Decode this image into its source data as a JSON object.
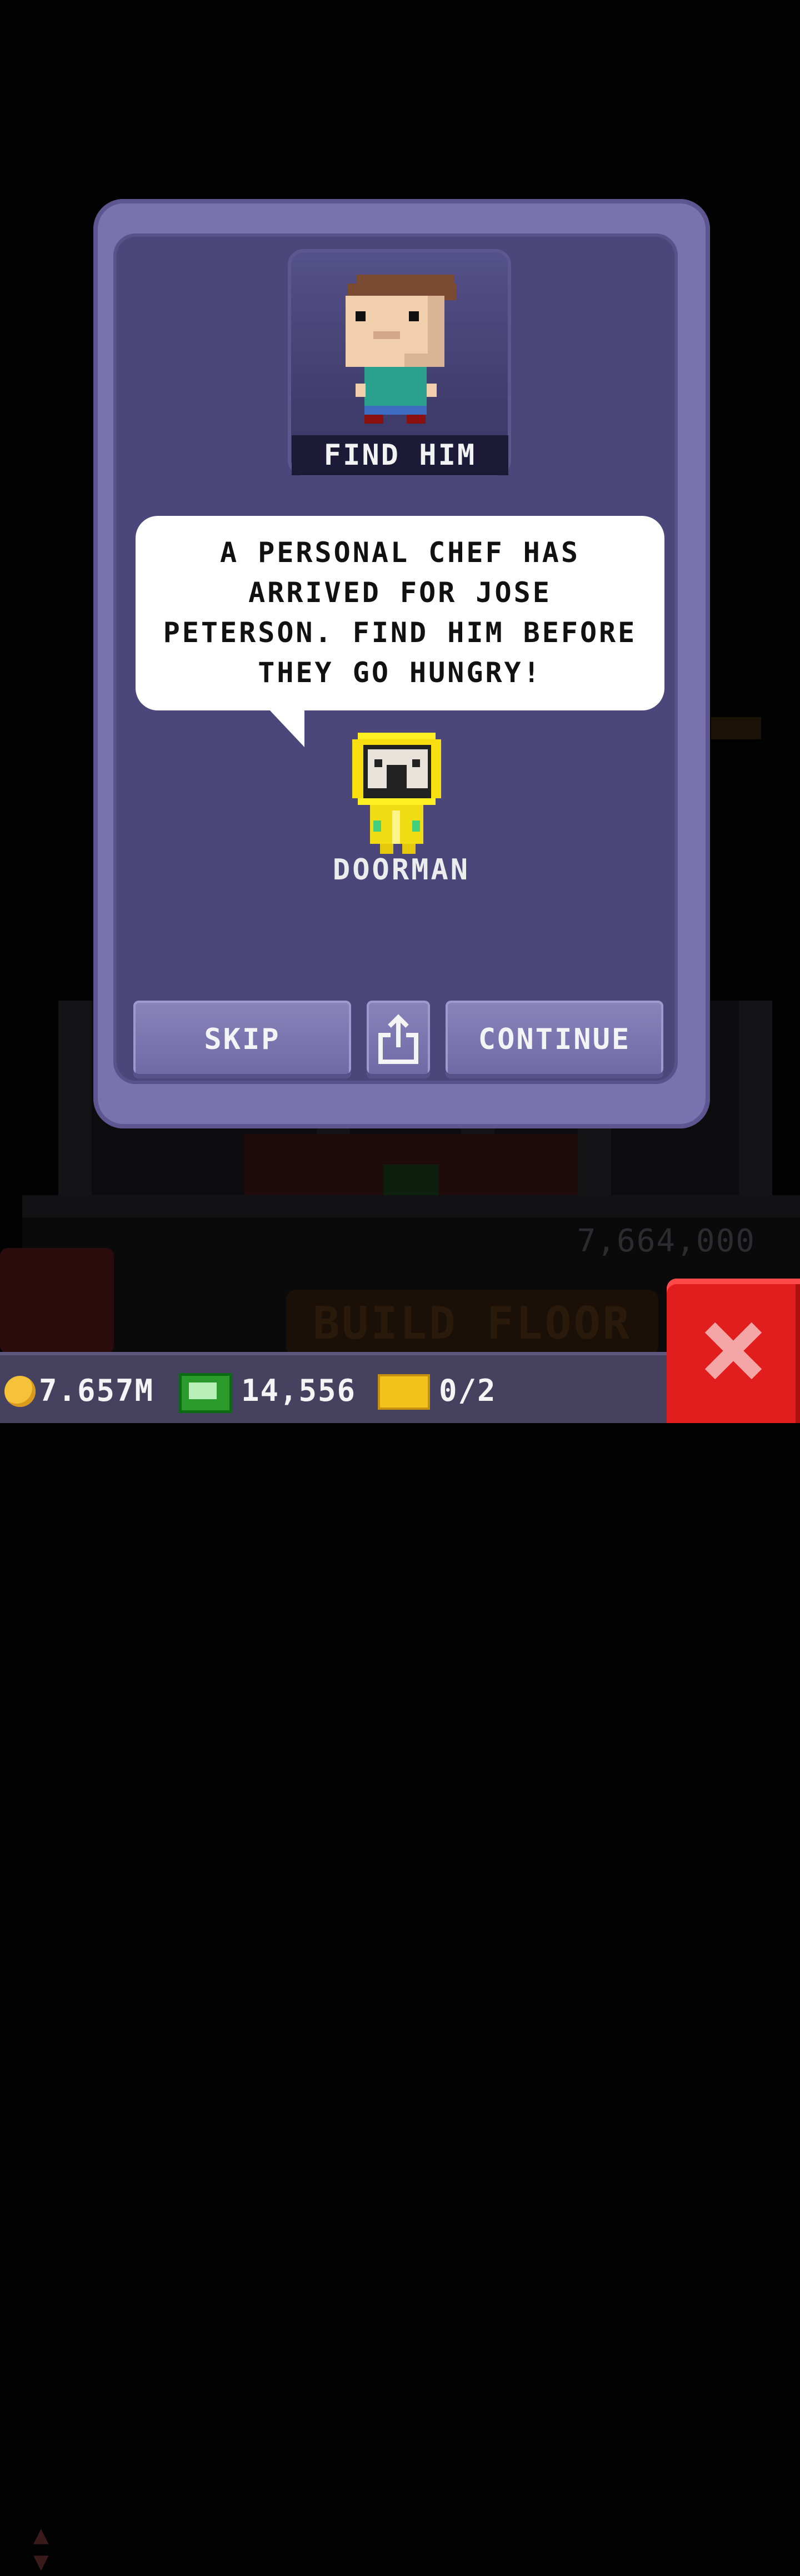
{
  "dialog": {
    "portrait_label": "FIND HIM",
    "message": "A PERSONAL CHEF HAS\nARRIVED FOR JOSE\nPETERSON. FIND HIM BEFORE\nTHEY GO HUNGRY!",
    "npc_name": "DOORMAN",
    "buttons": {
      "skip": "SKIP",
      "continue": "CONTINUE"
    }
  },
  "background": {
    "floor_price": "7,664,000",
    "build_floor_label": "BUILD FLOOR"
  },
  "status_bar": {
    "coins": "7.657M",
    "bux": "14,556",
    "tickets": "0/2"
  },
  "colors": {
    "dialog_border": "#7a72ae",
    "dialog_body": "#4b477a",
    "button": "#7b75b0",
    "close_button": "#e21d1d"
  }
}
